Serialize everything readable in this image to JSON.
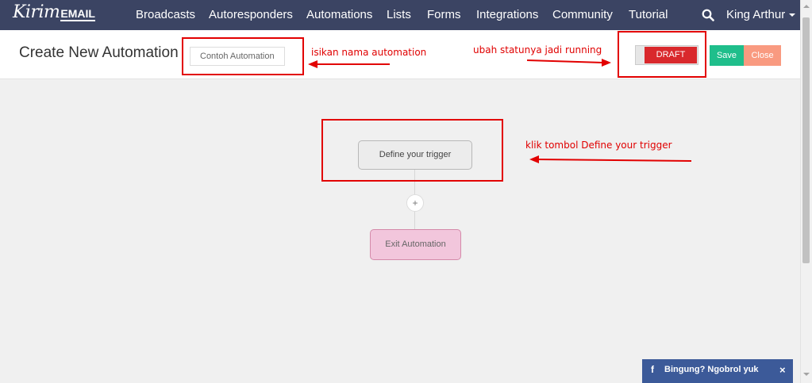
{
  "navbar": {
    "logo_script": "Kirim",
    "logo_text": "EMAIL",
    "items": [
      "Broadcasts",
      "Autoresponders",
      "Automations",
      "Lists",
      "Forms",
      "Integrations",
      "Community",
      "Tutorial"
    ],
    "user_name": "King Arthur",
    "icons": {
      "search": "search-icon",
      "user_menu": "caret-down-icon"
    }
  },
  "header": {
    "title": "Create New Automation",
    "name_input": {
      "value": "Contoh Automation",
      "placeholder": ""
    },
    "status": "DRAFT",
    "save_label": "Save",
    "close_label": "Close"
  },
  "canvas": {
    "trigger_label": "Define your trigger",
    "add_step_label": "+",
    "exit_label": "Exit Automation"
  },
  "annotations": {
    "name_hint": "isikan nama automation",
    "status_hint": "ubah statunya jadi running",
    "trigger_hint": "klik tombol Define your trigger"
  },
  "chat_widget": {
    "label": "Bingung? Ngobrol yuk",
    "icon_glyph": "f",
    "close_glyph": "×"
  },
  "colors": {
    "navbar": "#3b4463",
    "draft": "#d9282c",
    "save": "#1fbe8b",
    "close": "#f99a80",
    "exit_node": "#f2c6dc",
    "annotation": "#e20000",
    "chat": "#3c5a99"
  }
}
